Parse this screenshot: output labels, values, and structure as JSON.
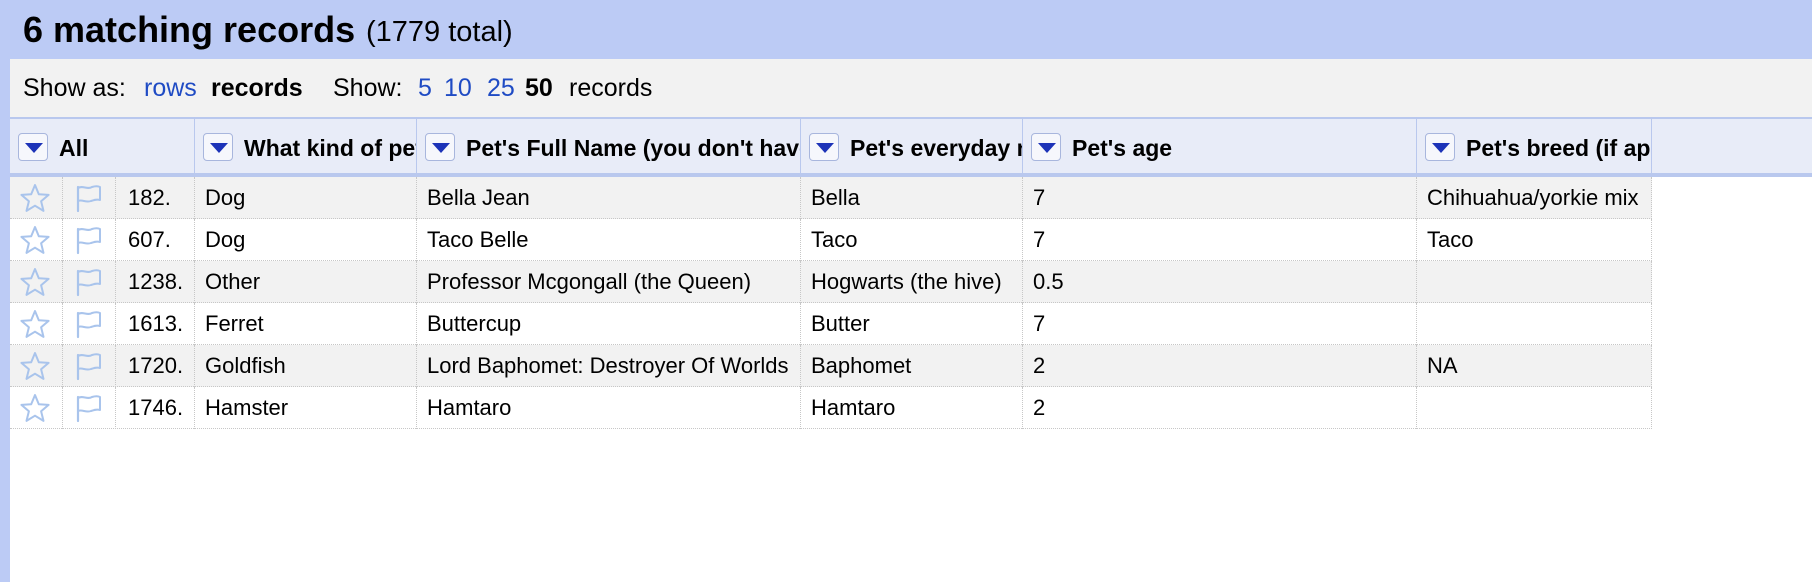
{
  "summary": {
    "count_text": "6 matching records",
    "total_text": "(1779 total)"
  },
  "view_bar": {
    "show_as_label": "Show as:",
    "rows_link": "rows",
    "records_current": "records",
    "show_label": "Show:",
    "page_sizes": [
      "5",
      "10",
      "25",
      "50"
    ],
    "page_size_selected": "50",
    "records_suffix": "records"
  },
  "columns": [
    {
      "label": "All"
    },
    {
      "label": "What kind of pet"
    },
    {
      "label": "Pet's Full Name (you don't have"
    },
    {
      "label": "Pet's everyday n"
    },
    {
      "label": "Pet's age"
    },
    {
      "label": "Pet's breed (if app"
    }
  ],
  "rows": [
    {
      "index": "182.",
      "kind": "Dog",
      "full_name": "Bella Jean",
      "everyday_name": "Bella",
      "age": "7",
      "breed": "Chihuahua/yorkie mix"
    },
    {
      "index": "607.",
      "kind": "Dog",
      "full_name": "Taco Belle",
      "everyday_name": "Taco",
      "age": "7",
      "breed": "Taco"
    },
    {
      "index": "1238.",
      "kind": "Other",
      "full_name": "Professor Mcgongall (the Queen)",
      "everyday_name": "Hogwarts (the hive)",
      "age": "0.5",
      "breed": ""
    },
    {
      "index": "1613.",
      "kind": "Ferret",
      "full_name": "Buttercup",
      "everyday_name": "Butter",
      "age": "7",
      "breed": ""
    },
    {
      "index": "1720.",
      "kind": "Goldfish",
      "full_name": "Lord Baphomet: Destroyer Of Worlds",
      "everyday_name": "Baphomet",
      "age": "2",
      "breed": "NA"
    },
    {
      "index": "1746.",
      "kind": "Hamster",
      "full_name": "Hamtaro",
      "everyday_name": "Hamtaro",
      "age": "2",
      "breed": ""
    }
  ],
  "icons": {
    "star": "star-icon",
    "flag": "flag-icon",
    "dropdown": "dropdown-arrow-icon"
  },
  "colors": {
    "summary_bg": "#bccbf5",
    "header_bg": "#e8ecf8",
    "link": "#1f4bc4",
    "odd_row": "#f2f2f2"
  }
}
